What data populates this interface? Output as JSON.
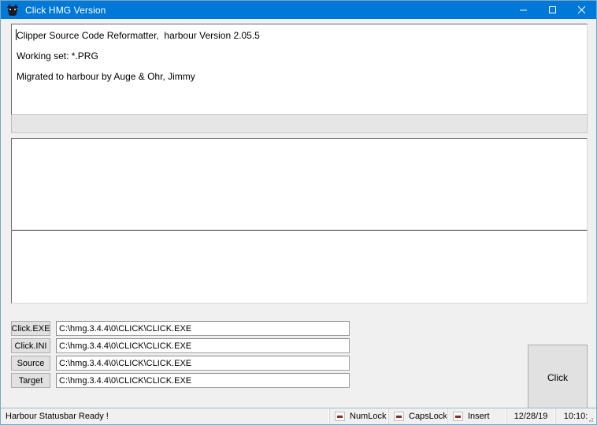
{
  "window": {
    "title": "Click HMG Version",
    "icon": "app-dog-icon",
    "accent_color": "#0078d7",
    "border_color": "#7aa8bf",
    "controls": {
      "minimize": "minimize-icon",
      "maximize": "maximize-icon",
      "close": "close-icon"
    }
  },
  "output_panel": {
    "lines": [
      "Clipper Source Code Reformatter,  harbour Version 2.05.5",
      "Working set: *.PRG",
      "Migrated to harbour by Auge & Ohr, Jimmy"
    ]
  },
  "progress": {
    "value": ""
  },
  "middle_panel": {
    "content": ""
  },
  "bottom_panel": {
    "content": ""
  },
  "fields": [
    {
      "label": "Click.EXE",
      "value": "C:\\hmg.3.4.4\\0\\CLICK\\CLICK.EXE",
      "placeholder": ""
    },
    {
      "label": "Click.INI",
      "value": "C:\\hmg.3.4.4\\0\\CLICK\\CLICK.EXE",
      "placeholder": ""
    },
    {
      "label": "Source",
      "value": "C:\\hmg.3.4.4\\0\\CLICK\\CLICK.EXE",
      "placeholder": ""
    },
    {
      "label": "Target",
      "value": "C:\\hmg.3.4.4\\0\\CLICK\\CLICK.EXE",
      "placeholder": ""
    }
  ],
  "action": {
    "click_label": "Click"
  },
  "statusbar": {
    "message": "Harbour Statusbar Ready !",
    "numlock": "NumLock",
    "capslock": "CapsLock",
    "insert": "Insert",
    "date": "12/28/19",
    "time": "10:10:"
  }
}
